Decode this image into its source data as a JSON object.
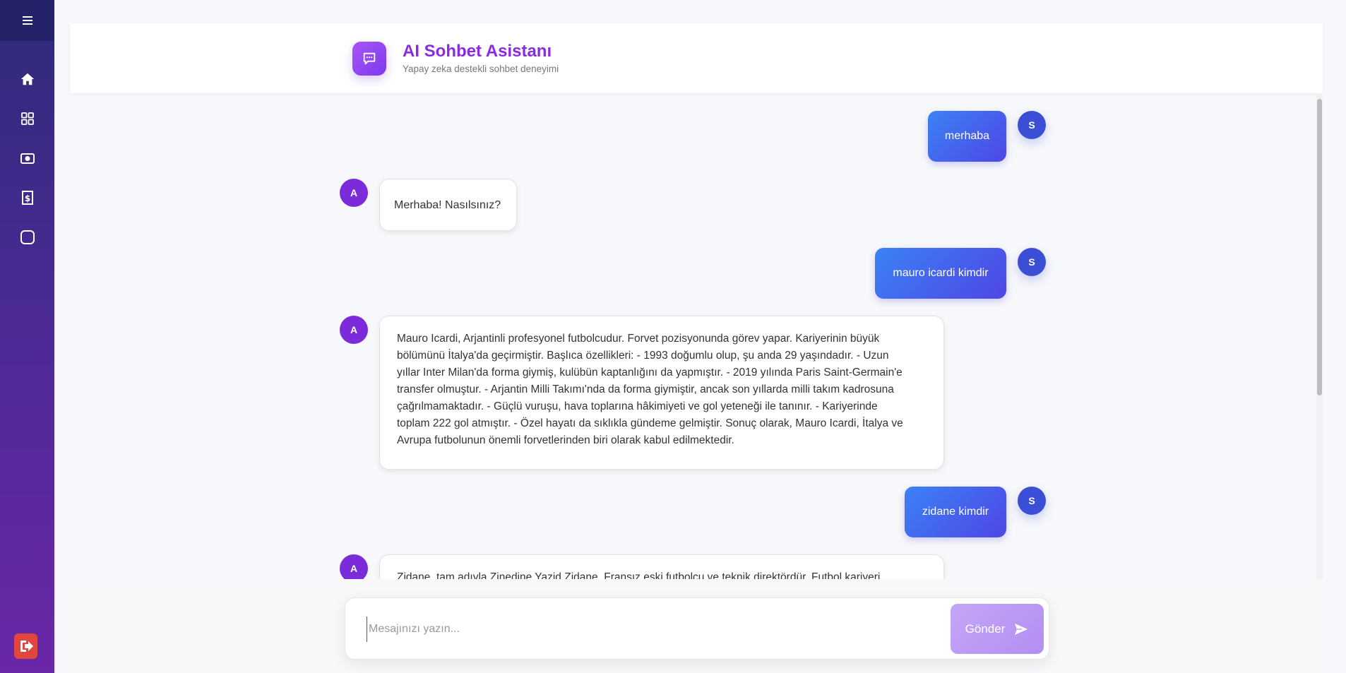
{
  "header": {
    "title": "AI Sohbet Asistanı",
    "subtitle": "Yapay zeka destekli sohbet deneyimi"
  },
  "sidebar": {
    "items": [
      {
        "icon": "home-icon"
      },
      {
        "icon": "grid-icon"
      },
      {
        "icon": "camera-icon"
      },
      {
        "icon": "dollar-document-icon"
      },
      {
        "icon": "square-icon"
      }
    ]
  },
  "avatars": {
    "user": "S",
    "ai": "A"
  },
  "messages": [
    {
      "role": "user",
      "text": "merhaba"
    },
    {
      "role": "ai",
      "text": "Merhaba! Nasılsınız?"
    },
    {
      "role": "user",
      "text": "mauro icardi kimdir"
    },
    {
      "role": "ai",
      "lines": [
        "Mauro Icardi, Arjantinli profesyonel futbolcudur. Forvet pozisyonunda görev yapar. Kariyerinin büyük",
        "bölümünü İtalya'da geçirmiştir. Başlıca özellikleri: - 1993 doğumlu olup, şu anda 29 yaşındadır. - Uzun",
        "yıllar Inter Milan'da forma giymiş, kulübün kaptanlığını da yapmıştır. - 2019 yılında Paris Saint-Germain'e",
        "transfer olmuştur. - Arjantin Milli Takımı'nda da forma giymiştir, ancak son yıllarda milli takım kadrosuna",
        "çağrılmamaktadır. - Güçlü vuruşu, hava toplarına hâkimiyeti ve gol yeteneği ile tanınır. - Kariyerinde",
        "toplam 222 gol atmıştır. - Özel hayatı da sıklıkla gündeme gelmiştir. Sonuç olarak, Mauro Icardi, İtalya ve",
        "Avrupa futbolunun önemli forvetlerinden biri olarak kabul edilmektedir."
      ]
    },
    {
      "role": "user",
      "text": "zidane kimdir"
    },
    {
      "role": "ai",
      "text": "Zidane, tam adıyla Zinedine Yazid Zidane, Fransız eski futbolcu ve teknik direktördür. Futbol kariyeri"
    }
  ],
  "composer": {
    "placeholder": "Mesajınızı yazın...",
    "send_label": "Gönder"
  }
}
